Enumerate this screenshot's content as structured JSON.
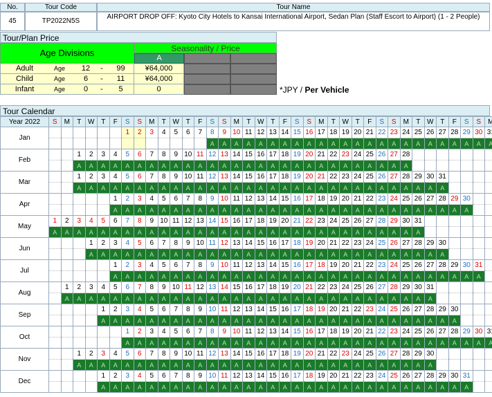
{
  "header": {
    "no_label": "No.",
    "code_label": "Tour Code",
    "name_label": "Tour Name",
    "no": "45",
    "code": "TP2022N5S",
    "name": "AIRPORT DROP OFF: Kyoto City Hotels to Kansai International Airport, Sedan Plan (Staff Escort to Airport) (1 - 2 People)"
  },
  "price": {
    "section_title": "Tour/Plan Price",
    "age_divisions_label": "Age Divisions",
    "seasonality_label": "Seasonality / Price",
    "season_a": "A",
    "rows": [
      {
        "label": "Adult",
        "age": "Age",
        "from": "12",
        "dash": "-",
        "to": "99",
        "price": "¥64,000"
      },
      {
        "label": "Child",
        "age": "Age",
        "from": "6",
        "dash": "-",
        "to": "11",
        "price": "¥64,000"
      },
      {
        "label": "Infant",
        "age": "Age",
        "from": "0",
        "dash": "-",
        "to": "5",
        "price": "0"
      }
    ],
    "note_prefix": "*JPY / ",
    "note_bold": "Per Vehicle"
  },
  "calendar": {
    "section_title": "Tour Calendar",
    "year_label": "Year 2022",
    "day_headers": [
      "S",
      "M",
      "T",
      "W",
      "T",
      "F",
      "S",
      "S",
      "M",
      "T",
      "W",
      "T",
      "F",
      "S",
      "S",
      "M",
      "T",
      "W",
      "T",
      "F",
      "S",
      "S",
      "M",
      "T",
      "W",
      "T",
      "F",
      "S",
      "S",
      "M",
      "T",
      "W",
      "T",
      "F",
      "S",
      "S",
      "M"
    ],
    "season_mark": "A",
    "months": [
      {
        "name": "Jan",
        "offset": 6,
        "days": 31,
        "avail_from": 8,
        "pre": [
          1,
          2
        ],
        "hol": [
          1,
          2,
          3,
          10
        ]
      },
      {
        "name": "Feb",
        "offset": 2,
        "days": 28,
        "avail_from": 1,
        "pre": [],
        "hol": [
          11,
          23
        ]
      },
      {
        "name": "Mar",
        "offset": 2,
        "days": 31,
        "avail_from": 1,
        "pre": [],
        "hol": [
          21
        ]
      },
      {
        "name": "Apr",
        "offset": 5,
        "days": 30,
        "avail_from": 1,
        "pre": [],
        "hol": [
          29
        ]
      },
      {
        "name": "May",
        "offset": 0,
        "days": 31,
        "avail_from": 1,
        "pre": [],
        "hol": [
          3,
          4,
          5
        ]
      },
      {
        "name": "Jun",
        "offset": 3,
        "days": 30,
        "avail_from": 1,
        "pre": [],
        "hol": []
      },
      {
        "name": "Jul",
        "offset": 5,
        "days": 31,
        "avail_from": 1,
        "pre": [],
        "hol": [
          18
        ]
      },
      {
        "name": "Aug",
        "offset": 1,
        "days": 31,
        "avail_from": 1,
        "pre": [],
        "hol": [
          11
        ]
      },
      {
        "name": "Sep",
        "offset": 4,
        "days": 30,
        "avail_from": 1,
        "pre": [],
        "hol": [
          19,
          23
        ]
      },
      {
        "name": "Oct",
        "offset": 6,
        "days": 31,
        "avail_from": 1,
        "pre": [],
        "hol": [
          10
        ]
      },
      {
        "name": "Nov",
        "offset": 2,
        "days": 30,
        "avail_from": 1,
        "pre": [],
        "hol": [
          3,
          23
        ]
      },
      {
        "name": "Dec",
        "offset": 4,
        "days": 31,
        "avail_from": 1,
        "pre": [],
        "hol": []
      }
    ]
  }
}
